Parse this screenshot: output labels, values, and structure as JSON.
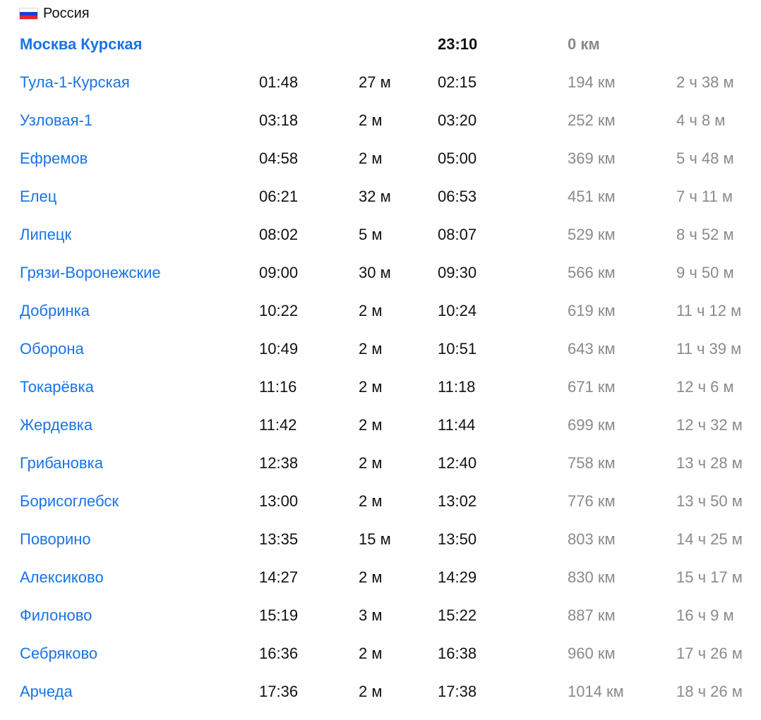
{
  "country": {
    "name": "Россия",
    "flag_icon": "russia-flag-icon",
    "flag_colors": [
      "#ffffff",
      "#1c3fd1",
      "#e1262c"
    ]
  },
  "colors": {
    "link": "#1a73e8",
    "muted": "#8a8a8a",
    "text": "#111111"
  },
  "stops": [
    {
      "station": "Москва Курская",
      "arrival": "",
      "stop": "",
      "departure": "23:10",
      "distance": "0 км",
      "duration": ""
    },
    {
      "station": "Тула-1-Курская",
      "arrival": "01:48",
      "stop": "27 м",
      "departure": "02:15",
      "distance": "194 км",
      "duration": "2 ч 38 м"
    },
    {
      "station": "Узловая-1",
      "arrival": "03:18",
      "stop": "2 м",
      "departure": "03:20",
      "distance": "252 км",
      "duration": "4 ч 8 м"
    },
    {
      "station": "Ефремов",
      "arrival": "04:58",
      "stop": "2 м",
      "departure": "05:00",
      "distance": "369 км",
      "duration": "5 ч 48 м"
    },
    {
      "station": "Елец",
      "arrival": "06:21",
      "stop": "32 м",
      "departure": "06:53",
      "distance": "451 км",
      "duration": "7 ч 11 м"
    },
    {
      "station": "Липецк",
      "arrival": "08:02",
      "stop": "5 м",
      "departure": "08:07",
      "distance": "529 км",
      "duration": "8 ч 52 м"
    },
    {
      "station": "Грязи-Воронежские",
      "arrival": "09:00",
      "stop": "30 м",
      "departure": "09:30",
      "distance": "566 км",
      "duration": "9 ч 50 м"
    },
    {
      "station": "Добринка",
      "arrival": "10:22",
      "stop": "2 м",
      "departure": "10:24",
      "distance": "619 км",
      "duration": "11 ч 12 м"
    },
    {
      "station": "Оборона",
      "arrival": "10:49",
      "stop": "2 м",
      "departure": "10:51",
      "distance": "643 км",
      "duration": "11 ч 39 м"
    },
    {
      "station": "Токарёвка",
      "arrival": "11:16",
      "stop": "2 м",
      "departure": "11:18",
      "distance": "671 км",
      "duration": "12 ч 6 м"
    },
    {
      "station": "Жердевка",
      "arrival": "11:42",
      "stop": "2 м",
      "departure": "11:44",
      "distance": "699 км",
      "duration": "12 ч 32 м"
    },
    {
      "station": "Грибановка",
      "arrival": "12:38",
      "stop": "2 м",
      "departure": "12:40",
      "distance": "758 км",
      "duration": "13 ч 28 м"
    },
    {
      "station": "Борисоглебск",
      "arrival": "13:00",
      "stop": "2 м",
      "departure": "13:02",
      "distance": "776 км",
      "duration": "13 ч 50 м"
    },
    {
      "station": "Поворино",
      "arrival": "13:35",
      "stop": "15 м",
      "departure": "13:50",
      "distance": "803 км",
      "duration": "14 ч 25 м"
    },
    {
      "station": "Алексиково",
      "arrival": "14:27",
      "stop": "2 м",
      "departure": "14:29",
      "distance": "830 км",
      "duration": "15 ч 17 м"
    },
    {
      "station": "Филоново",
      "arrival": "15:19",
      "stop": "3 м",
      "departure": "15:22",
      "distance": "887 км",
      "duration": "16 ч 9 м"
    },
    {
      "station": "Себряково",
      "arrival": "16:36",
      "stop": "2 м",
      "departure": "16:38",
      "distance": "960 км",
      "duration": "17 ч 26 м"
    },
    {
      "station": "Арчеда",
      "arrival": "17:36",
      "stop": "2 м",
      "departure": "17:38",
      "distance": "1014 км",
      "duration": "18 ч 26 м"
    }
  ]
}
